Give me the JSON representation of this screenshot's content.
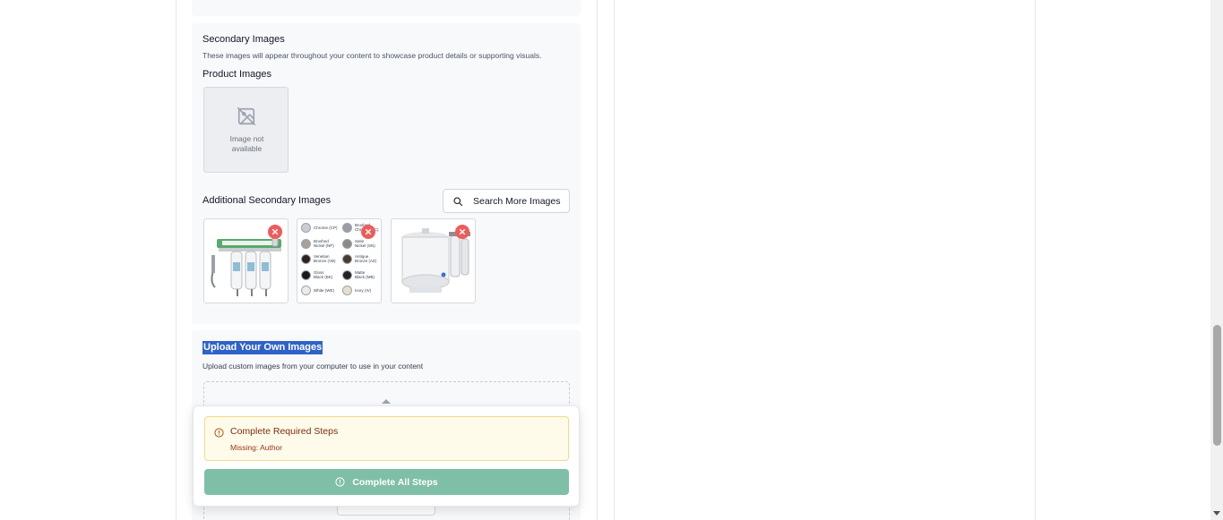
{
  "secondary": {
    "title": "Secondary Images",
    "description": "These images will appear throughout your content to showcase product details or supporting visuals.",
    "product_images_title": "Product Images",
    "placeholder_line1": "Image not",
    "placeholder_line2": "available",
    "additional_title": "Additional Secondary Images",
    "search_button": "Search More Images"
  },
  "finishes": [
    {
      "line1": "Chrome (CP)",
      "line2": "",
      "color": "#c9ccd1"
    },
    {
      "line1": "Brushed",
      "line2": "Chrome (BC)",
      "color": "#9a9da2"
    },
    {
      "line1": "Brushed",
      "line2": "Nickel (NP)",
      "color": "#a8a294"
    },
    {
      "line1": "Satin",
      "line2": "Nickel (SN)",
      "color": "#8d8a84"
    },
    {
      "line1": "Venetian",
      "line2": "Bronze (VB)",
      "color": "#2b2220"
    },
    {
      "line1": "Antique",
      "line2": "Bronze (AZ)",
      "color": "#4a3a2e"
    },
    {
      "line1": "Gloss",
      "line2": "Black (BK)",
      "color": "#1a1a1a"
    },
    {
      "line1": "Matte",
      "line2": "Black (MB)",
      "color": "#222222"
    },
    {
      "line1": "White (WE)",
      "line2": "",
      "color": "#ecebe6"
    },
    {
      "line1": "Ivory (IV)",
      "line2": "",
      "color": "#e6dfcc"
    }
  ],
  "upload": {
    "title": "Upload Your Own Images",
    "description": "Upload custom images from your computer to use in your content"
  },
  "popover": {
    "warning_title": "Complete Required Steps",
    "warning_missing": "Missing: Author",
    "button_label": "Complete All Steps"
  },
  "colors": {
    "accent_green": "#7fbfa8",
    "remove_red": "#ef5b5b",
    "selection_blue": "#2f62c9",
    "warning_bg": "#fffbeb"
  }
}
